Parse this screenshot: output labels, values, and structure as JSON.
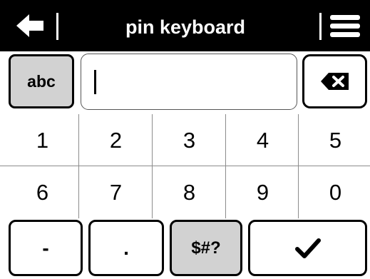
{
  "header": {
    "title": "pin keyboard",
    "back_icon": "arrow-left-icon",
    "menu_icon": "hamburger-menu-icon",
    "background": "#000000"
  },
  "input": {
    "mode_button_label": "abc",
    "value": "",
    "backspace_icon": "backspace-icon"
  },
  "keys": {
    "row1": [
      "1",
      "2",
      "3",
      "4",
      "5"
    ],
    "row2": [
      "6",
      "7",
      "8",
      "9",
      "0"
    ]
  },
  "bottom": {
    "dash_label": "-",
    "dot_label": ".",
    "symbols_label": "$#?",
    "confirm_icon": "checkmark-icon"
  },
  "colors": {
    "accent_gray": "#d2d2d2",
    "grid_line": "#8c8c8c"
  }
}
